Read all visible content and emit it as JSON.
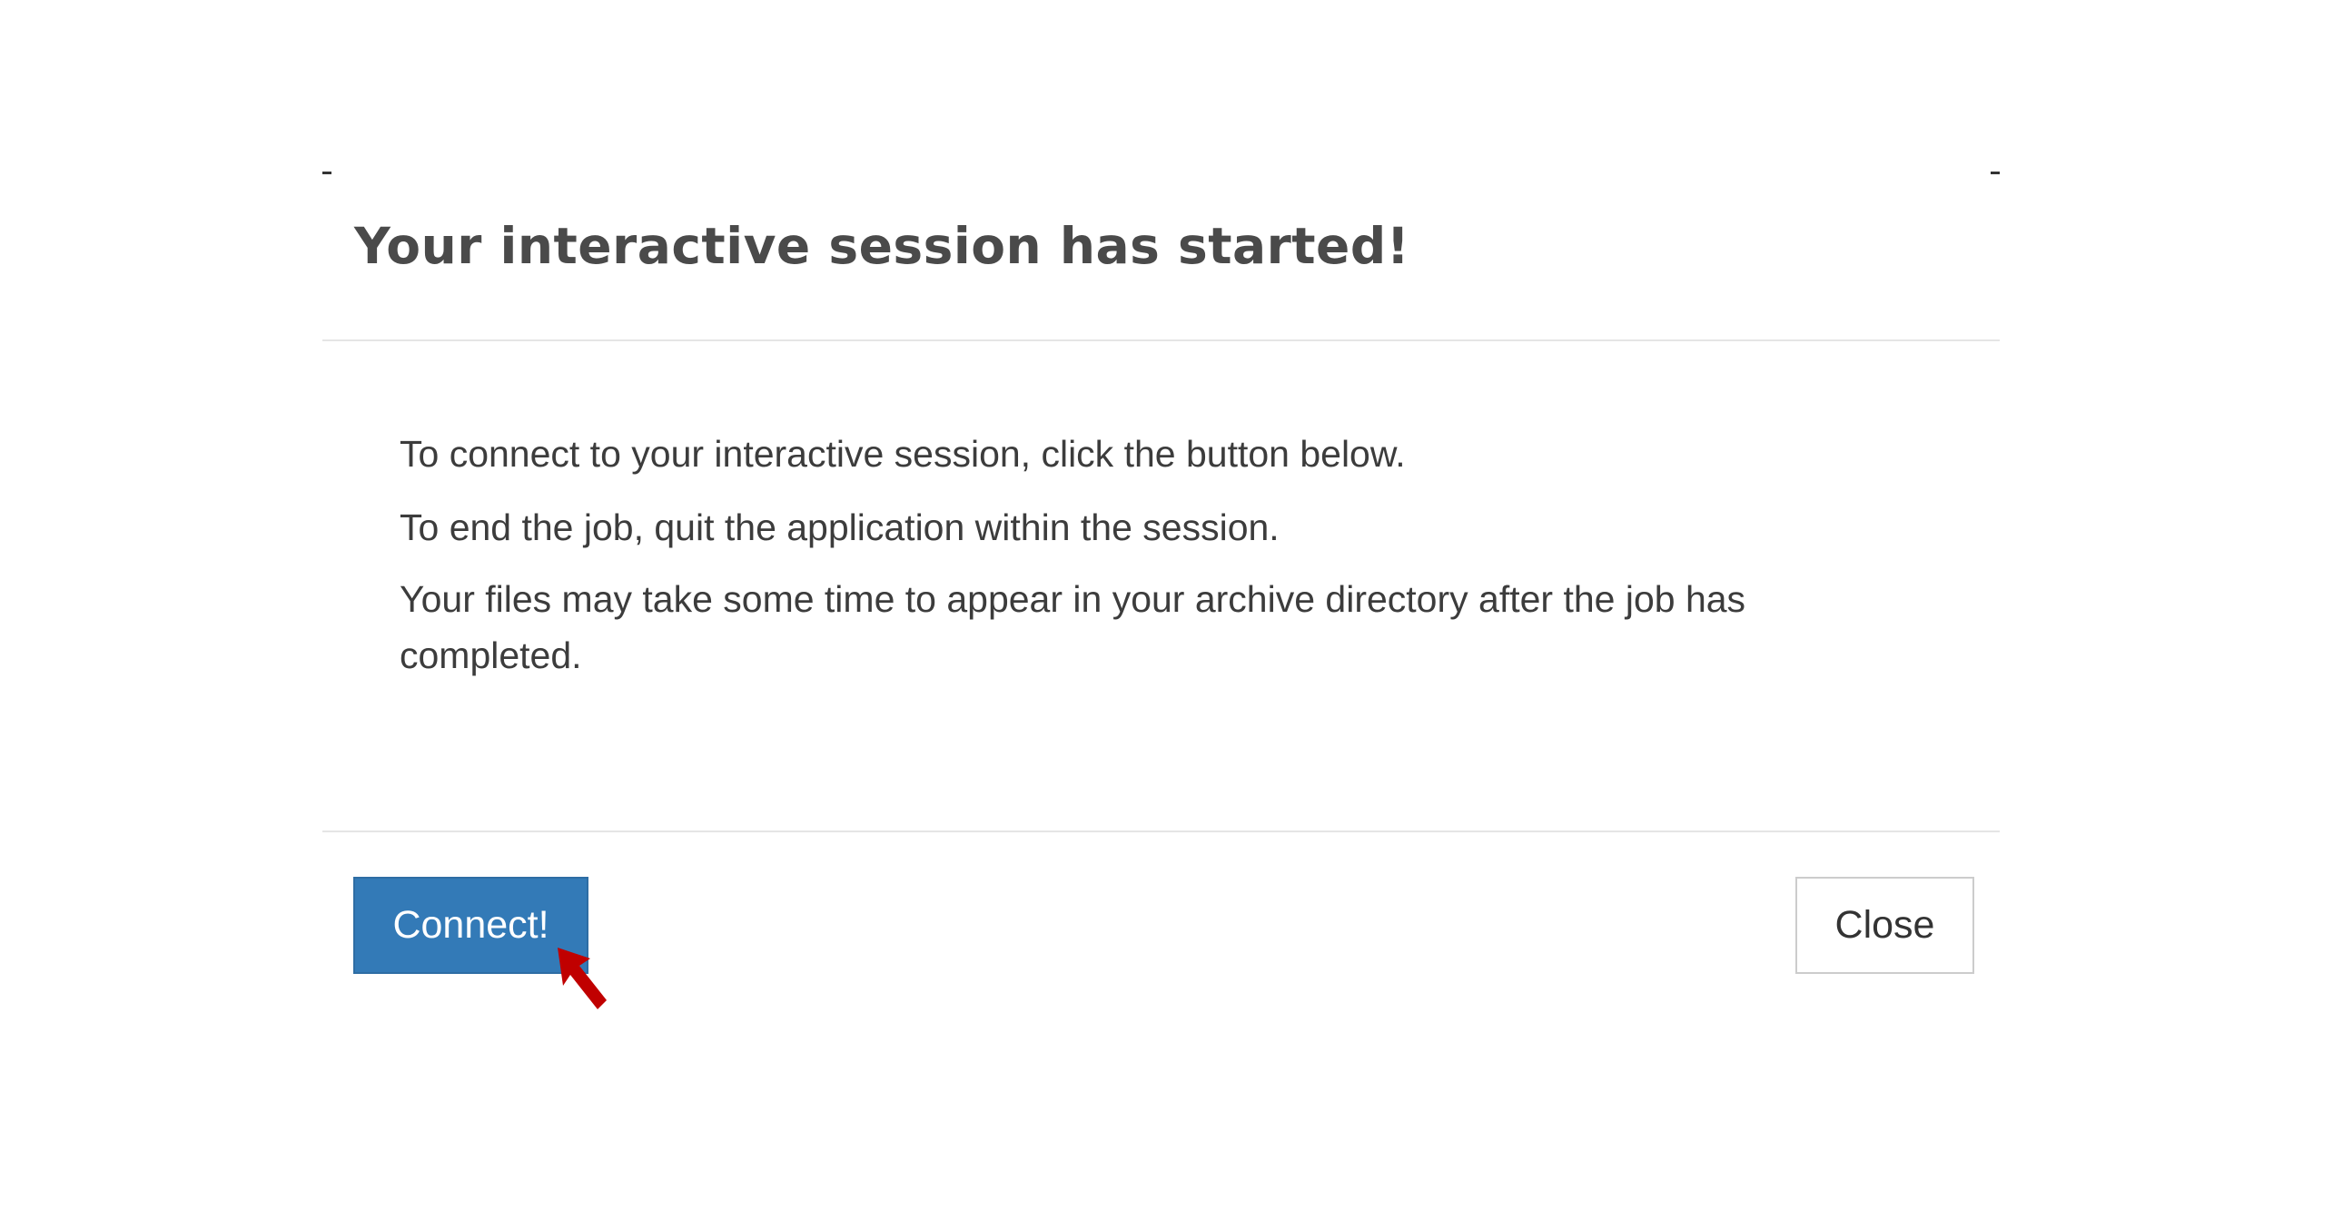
{
  "dialog": {
    "title": "Your interactive session has started!",
    "body": {
      "paragraphs": [
        "To connect to your interactive session, click the button below.",
        "To end the job, quit the application within the session.",
        "Your files may take some time to appear in your archive directory after the job has completed."
      ]
    },
    "footer": {
      "connect_label": "Connect!",
      "close_label": "Close"
    }
  },
  "colors": {
    "primary_button": "#337ab7",
    "pointer_arrow": "#c00000",
    "title_text": "#4a4a4a",
    "divider": "#e5e5e5"
  },
  "icons": {
    "pointer": "red-arrow-pointer-icon"
  }
}
